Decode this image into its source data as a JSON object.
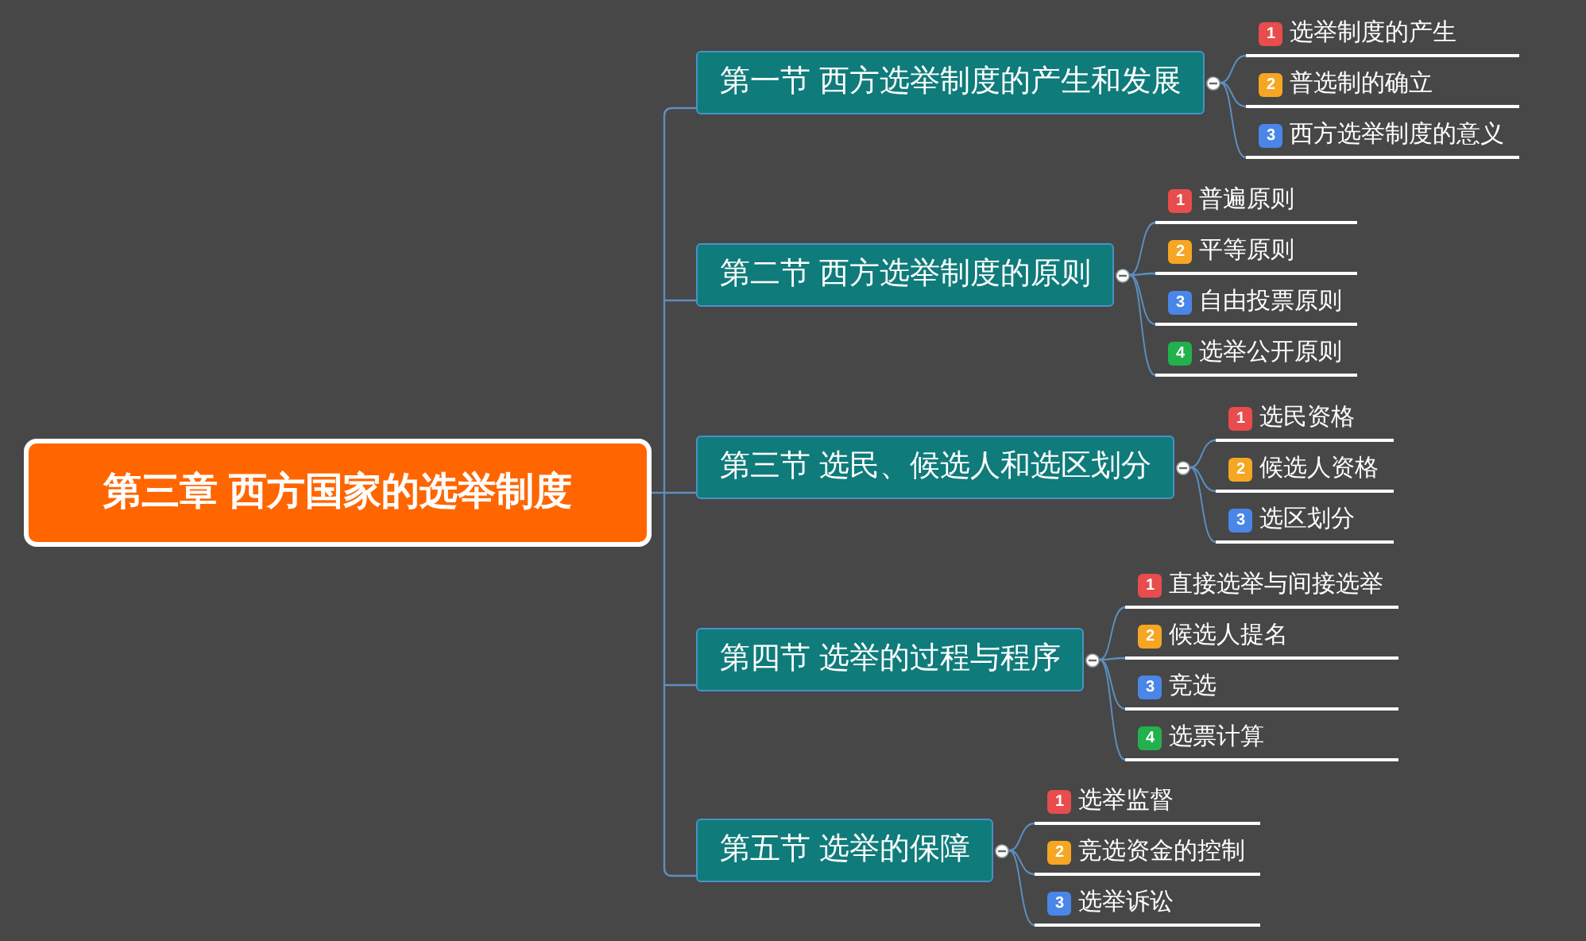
{
  "root": {
    "title": "第三章 西方国家的选举制度"
  },
  "sections": [
    {
      "title": "第一节 西方选举制度的产生和发展",
      "expanded": true,
      "children": [
        {
          "badge": "1",
          "color": "#e84c4c",
          "label": "选举制度的产生"
        },
        {
          "badge": "2",
          "color": "#f5a623",
          "label": "普选制的确立"
        },
        {
          "badge": "3",
          "color": "#4a86e8",
          "label": "西方选举制度的意义"
        }
      ]
    },
    {
      "title": "第二节 西方选举制度的原则",
      "expanded": true,
      "children": [
        {
          "badge": "1",
          "color": "#e84c4c",
          "label": "普遍原则"
        },
        {
          "badge": "2",
          "color": "#f5a623",
          "label": "平等原则"
        },
        {
          "badge": "3",
          "color": "#4a86e8",
          "label": "自由投票原则"
        },
        {
          "badge": "4",
          "color": "#22b14c",
          "label": "选举公开原则"
        }
      ]
    },
    {
      "title": "第三节 选民、候选人和选区划分",
      "expanded": true,
      "children": [
        {
          "badge": "1",
          "color": "#e84c4c",
          "label": "选民资格"
        },
        {
          "badge": "2",
          "color": "#f5a623",
          "label": "候选人资格"
        },
        {
          "badge": "3",
          "color": "#4a86e8",
          "label": "选区划分"
        }
      ]
    },
    {
      "title": "第四节 选举的过程与程序",
      "expanded": true,
      "children": [
        {
          "badge": "1",
          "color": "#e84c4c",
          "label": "直接选举与间接选举"
        },
        {
          "badge": "2",
          "color": "#f5a623",
          "label": "候选人提名"
        },
        {
          "badge": "3",
          "color": "#4a86e8",
          "label": "竞选"
        },
        {
          "badge": "4",
          "color": "#22b14c",
          "label": "选票计算"
        }
      ]
    },
    {
      "title": "第五节 选举的保障",
      "expanded": true,
      "children": [
        {
          "badge": "1",
          "color": "#e84c4c",
          "label": "选举监督"
        },
        {
          "badge": "2",
          "color": "#f5a623",
          "label": "竞选资金的控制"
        },
        {
          "badge": "3",
          "color": "#4a86e8",
          "label": "选举诉讼"
        }
      ]
    }
  ]
}
